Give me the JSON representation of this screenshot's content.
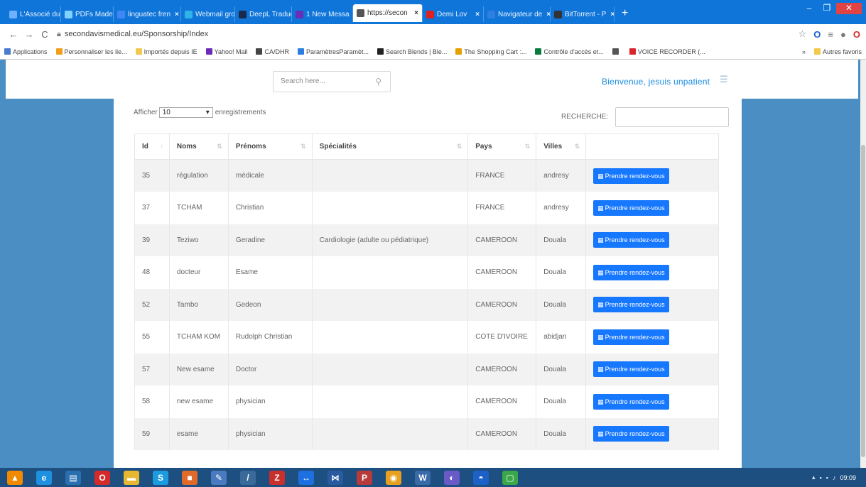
{
  "browser": {
    "tabs": [
      {
        "title": "L'Associé du c",
        "color": "#6fb1ff",
        "active": false
      },
      {
        "title": "PDFs Made Si",
        "color": "#7fd1ff",
        "active": false
      },
      {
        "title": "linguatec fren",
        "color": "#4285f4",
        "active": false
      },
      {
        "title": "Webmail grou",
        "color": "#2fb3e8",
        "active": false
      },
      {
        "title": "DeepL Traduc",
        "color": "#1a2a4a",
        "active": false
      },
      {
        "title": "1 New Messa",
        "color": "#6b2cb8",
        "active": false
      },
      {
        "title": "https://secon",
        "color": "#555555",
        "active": true
      },
      {
        "title": "Demi Lov",
        "color": "#e02020",
        "active": false
      },
      {
        "title": "Navigateur de",
        "color": "#2f7fe0",
        "active": false
      },
      {
        "title": "BitTorrent - P",
        "color": "#333333",
        "active": false
      }
    ],
    "new_tab": "+",
    "url": "secondavismedical.eu/Sponsorship/Index",
    "bookmarks": [
      {
        "label": "Applications",
        "color": "#4a7bd0"
      },
      {
        "label": "Personnaliser les lie...",
        "color": "#f29d1c"
      },
      {
        "label": "Importés depuis IE",
        "color": "#f2c94c"
      },
      {
        "label": "Yahoo! Mail",
        "color": "#6b2cb8"
      },
      {
        "label": "CA/DHR",
        "color": "#444444"
      },
      {
        "label": "ParamètresParamèt...",
        "color": "#2a7de1"
      },
      {
        "label": "Search Blends | Ble...",
        "color": "#222222"
      },
      {
        "label": "The Shopping Cart :...",
        "color": "#e5a000"
      },
      {
        "label": "Contrôle d'accès et...",
        "color": "#0a7b3e"
      },
      {
        "label": "",
        "color": "#555555"
      },
      {
        "label": "VOICE RECORDER (...",
        "color": "#d9262c"
      }
    ],
    "bookmarks_overflow": "»",
    "other_bookmarks": "Autres favoris"
  },
  "header": {
    "search_placeholder": "Search here...",
    "welcome": "Bienvenue, jesuis unpatient"
  },
  "table_controls": {
    "show_prefix": "Afficher",
    "page_length": "10",
    "show_suffix": "enregistrements",
    "search_label": "RECHERCHE:"
  },
  "table": {
    "columns": [
      "Id",
      "Noms",
      "Prénoms",
      "Spécialités",
      "Pays",
      "Villes",
      ""
    ],
    "action_label": "Prendre rendez-vous",
    "rows": [
      {
        "id": "35",
        "nom": "régulation",
        "prenom": "médicale",
        "specialite": "",
        "pays": "FRANCE",
        "ville": "andresy"
      },
      {
        "id": "37",
        "nom": "TCHAM",
        "prenom": "Christian",
        "specialite": "",
        "pays": "FRANCE",
        "ville": "andresy"
      },
      {
        "id": "39",
        "nom": "Teziwo",
        "prenom": "Geradine",
        "specialite": "Cardiologie (adulte ou pédiatrique)",
        "pays": "CAMEROON",
        "ville": "Douala"
      },
      {
        "id": "48",
        "nom": "docteur",
        "prenom": "Esame",
        "specialite": "",
        "pays": "CAMEROON",
        "ville": "Douala"
      },
      {
        "id": "52",
        "nom": "Tambo",
        "prenom": "Gedeon",
        "specialite": "",
        "pays": "CAMEROON",
        "ville": "Douala"
      },
      {
        "id": "55",
        "nom": "TCHAM KOM",
        "prenom": "Rudolph Christian",
        "specialite": "",
        "pays": "COTE D'IVOIRE",
        "ville": "abidjan"
      },
      {
        "id": "57",
        "nom": "New esame",
        "prenom": "Doctor",
        "specialite": "",
        "pays": "CAMEROON",
        "ville": "Douala"
      },
      {
        "id": "58",
        "nom": "new esame",
        "prenom": "physician",
        "specialite": "",
        "pays": "CAMEROON",
        "ville": "Douala"
      },
      {
        "id": "59",
        "nom": "esame",
        "prenom": "physician",
        "specialite": "",
        "pays": "CAMEROON",
        "ville": "Douala"
      }
    ]
  },
  "taskbar": {
    "apps": [
      {
        "name": "vlc-icon",
        "color": "#f08a00",
        "glyph": "▲"
      },
      {
        "name": "ie-icon",
        "color": "#1e90e0",
        "glyph": "e"
      },
      {
        "name": "store-icon",
        "color": "#2a6fb0",
        "glyph": "▤"
      },
      {
        "name": "opera-icon",
        "color": "#d42a2a",
        "glyph": "O"
      },
      {
        "name": "folder-icon",
        "color": "#e8b730",
        "glyph": "▬"
      },
      {
        "name": "skype-icon",
        "color": "#1c9ce0",
        "glyph": "S"
      },
      {
        "name": "app-icon",
        "color": "#e06a2a",
        "glyph": "■"
      },
      {
        "name": "paint-icon",
        "color": "#4a7ac0",
        "glyph": "✎"
      },
      {
        "name": "tool-icon",
        "color": "#3a6a9a",
        "glyph": "/"
      },
      {
        "name": "filezilla-icon",
        "color": "#c9302c",
        "glyph": "Z"
      },
      {
        "name": "teamviewer-icon",
        "color": "#1e6fe0",
        "glyph": "↔"
      },
      {
        "name": "vs-icon",
        "color": "#2a5aa0",
        "glyph": "⋈"
      },
      {
        "name": "publisher-icon",
        "color": "#b83a3a",
        "glyph": "P"
      },
      {
        "name": "chrome-icon",
        "color": "#e8a020",
        "glyph": "◉"
      },
      {
        "name": "word-icon",
        "color": "#3a6aa8",
        "glyph": "W"
      },
      {
        "name": "eclipse-icon",
        "color": "#6a5ac8",
        "glyph": "◐"
      },
      {
        "name": "chat-icon",
        "color": "#1c60c8",
        "glyph": "◓"
      },
      {
        "name": "green-app-icon",
        "color": "#3aa84a",
        "glyph": "▢"
      }
    ],
    "time": "09:09"
  }
}
